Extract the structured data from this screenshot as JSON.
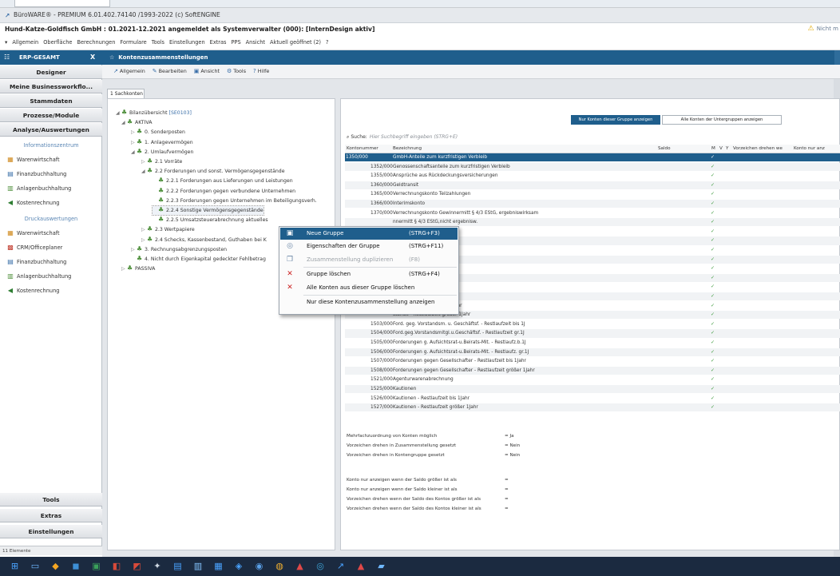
{
  "window": {
    "title": "BüroWARE® - PREMIUM 6.01.402.74140 /1993-2022 (c) SoftENGINE",
    "info": "Hund-Katze-Goldfisch GmbH : 01.2021-12.2021 angemeldet als Systemverwalter (000): [InternDesign aktiv]",
    "warning": "Nicht m"
  },
  "menu": [
    "Allgemein",
    "Oberfläche",
    "Berechnungen",
    "Formulare",
    "Tools",
    "Einstellungen",
    "Extras",
    "PPS",
    "Ansicht",
    "Aktuell geöffnet (2)",
    "?"
  ],
  "left_panel": {
    "header": "ERP-GESAMT",
    "close": "X",
    "buttons_top": [
      "Designer",
      "Meine Businessworkflo...",
      "Stammdaten",
      "Prozesse/Module",
      "Analyse/Auswertungen"
    ],
    "group1": "Informationszentrum",
    "items1": [
      {
        "label": "Warenwirtschaft",
        "icon": "package-icon"
      },
      {
        "label": "Finanzbuchhaltung",
        "icon": "finance-icon"
      },
      {
        "label": "Anlagenbuchhaltung",
        "icon": "chart-icon"
      },
      {
        "label": "Kostenrechnung",
        "icon": "cost-icon"
      }
    ],
    "group2": "Druckauswertungen",
    "items2": [
      {
        "label": "Warenwirtschaft",
        "icon": "package-icon"
      },
      {
        "label": "CRM/Officeplaner",
        "icon": "calendar-icon"
      },
      {
        "label": "Finanzbuchhaltung",
        "icon": "finance-icon"
      },
      {
        "label": "Anlagenbuchhaltung",
        "icon": "chart-icon"
      },
      {
        "label": "Kostenrechnung",
        "icon": "cost-icon"
      }
    ],
    "buttons_bottom": [
      "Tools",
      "Extras",
      "Einstellungen"
    ],
    "status": "11 Elemente"
  },
  "document": {
    "title": "Kontenzusammenstellungen",
    "toolbar": [
      "Allgemein",
      "Bearbeiten",
      "Ansicht",
      "Tools",
      "Hilfe"
    ],
    "subtab": "1 Sachkonten"
  },
  "tree": [
    {
      "label": "Bilanzübersicht",
      "extra": "[SE0103]",
      "level": 0,
      "toggle": "◢"
    },
    {
      "label": "AKTIVA",
      "level": 1,
      "toggle": "◢"
    },
    {
      "label": "0. Sonderposten",
      "level": 2,
      "toggle": "▷"
    },
    {
      "label": "1. Anlagevermögen",
      "level": 2,
      "toggle": "▷"
    },
    {
      "label": "2. Umlaufvermögen",
      "level": 2,
      "toggle": "◢"
    },
    {
      "label": "2.1 Vorräte",
      "level": 3,
      "toggle": "▷"
    },
    {
      "label": "2.2 Forderungen und sonst. Vermögensgegenstände",
      "level": 3,
      "toggle": "◢"
    },
    {
      "label": "2.2.1 Forderungen aus Lieferungen und Leistungen",
      "level": 4,
      "toggle": ""
    },
    {
      "label": "2.2.2 Forderungen gegen verbundene Unternehmen",
      "level": 4,
      "toggle": ""
    },
    {
      "label": "2.2.3 Forderungen gegen Unternehmen im Beteiligungsverh.",
      "level": 4,
      "toggle": ""
    },
    {
      "label": "2.2.4 Sonstige Vermögensgegenstände",
      "level": 4,
      "toggle": ""
    },
    {
      "label": "2.2.5 Umsatzsteuerabrechnung aktuelles",
      "level": 4,
      "toggle": ""
    },
    {
      "label": "2.3 Wertpapiere",
      "level": 3,
      "toggle": "▷"
    },
    {
      "label": "2.4 Schecks, Kassenbestand, Guthaben bei K",
      "level": 3,
      "toggle": "▷"
    },
    {
      "label": "3. Rechnungsabgrenzungsposten",
      "level": 2,
      "toggle": "▷"
    },
    {
      "label": "4. Nicht durch Eigenkapital gedeckter Fehlbetrag",
      "level": 2,
      "toggle": ""
    },
    {
      "label": "PASSIVA",
      "level": 1,
      "toggle": "▷"
    }
  ],
  "right": {
    "btn_nur": "Nur Konten dieser Gruppe anzeigen",
    "btn_alle": "Alle Konten der Untergruppen anzeigen",
    "search_label": "Suche:",
    "search_placeholder": "Hier Suchbegriff eingeben (STRG+E)",
    "columns": [
      "Kontonummer",
      "Bezeichnung",
      "Saldo",
      "M",
      "V",
      "Y",
      "Vorzeichen drehen we",
      "Konto nur anz"
    ],
    "rows": [
      {
        "num": "1350/000",
        "name": "GmbH-Anteile zum kurzfristigen Verbleib",
        "sel": true
      },
      {
        "num": "1352/000",
        "name": "Genossenschaftsanteile zum kurzfristigen Verbleib"
      },
      {
        "num": "1355/000",
        "name": "Ansprüche aus Rückdeckungsversicherungen"
      },
      {
        "num": "1360/000",
        "name": "Geldtransit"
      },
      {
        "num": "1365/000",
        "name": "Verrechnungskonto Teilzahlungen"
      },
      {
        "num": "1366/000",
        "name": "Interimskonto"
      },
      {
        "num": "1370/000",
        "name": "Verrechnungskonto Gewinnermitt § 4/3 EStG, ergebniswirksam"
      },
      {
        "num": "",
        "name": "nnermitt § 4/3 EStG,nicht ergebnisw."
      },
      {
        "num": "",
        "name": ""
      },
      {
        "num": "",
        "name": ""
      },
      {
        "num": "",
        "name": ""
      },
      {
        "num": "",
        "name": ""
      },
      {
        "num": "",
        "name": ""
      },
      {
        "num": "",
        "name": "stellen"
      },
      {
        "num": "",
        "name": "esteuerung"
      },
      {
        "num": "",
        "name": "stände"
      },
      {
        "num": "",
        "name": "stände - Restlaufzeit bis 1Jahr"
      },
      {
        "num": "",
        "name": "stände - Restlaufzeit größer 1Jahr"
      },
      {
        "num": "1503/000",
        "name": "Ford. geg. Vorstandsm. u. Geschäftsf. - Restlaufzeit bis 1J"
      },
      {
        "num": "1504/000",
        "name": "Ford.geg.Vorstandsmitgl.u.Geschäftsf. - Restlaufzeit gr.1J"
      },
      {
        "num": "1505/000",
        "name": "Forderungen g. Aufsichtsrat-u.Beirats-Mit. - Restlaufz.b.1J"
      },
      {
        "num": "1506/000",
        "name": "Forderungen g. Aufsichtsrat-u.Beirats-Mit. - Restlaufz. gr.1J"
      },
      {
        "num": "1507/000",
        "name": "Forderungen gegen Gesellschafter - Restlaufzeit bis 1Jahr"
      },
      {
        "num": "1508/000",
        "name": "Forderungen gegen Gesellschafter - Restlaufzeit größer 1Jahr"
      },
      {
        "num": "1521/000",
        "name": "Agenturwarenabrechnung"
      },
      {
        "num": "1525/000",
        "name": "Kautionen"
      },
      {
        "num": "1526/000",
        "name": "Kautionen - Restlaufzeit bis 1Jahr"
      },
      {
        "num": "1527/000",
        "name": "Kautionen - Restlaufzeit größer 1Jahr"
      }
    ],
    "checkmark": "✓",
    "props": [
      {
        "label": "Mehrfachzuordnung von Konten möglich",
        "value": "= Ja"
      },
      {
        "label": "Vorzeichen drehen in Zusammenstellung gesetzt",
        "value": "= Nein"
      },
      {
        "label": "Vorzeichen drehen in Kontengruppe gesetzt",
        "value": "= Nein"
      },
      {
        "label": "",
        "value": ""
      },
      {
        "label": "Konto nur anzeigen wenn der Saldo größer ist als",
        "value": "="
      },
      {
        "label": "Konto nur anzeigen wenn der Saldo kleiner ist als",
        "value": "="
      },
      {
        "label": "Vorzeichen drehen wenn der Saldo des Kontos größer ist als",
        "value": "="
      },
      {
        "label": "Vorzeichen drehen wenn der Saldo des Kontos kleiner ist als",
        "value": "="
      }
    ]
  },
  "context_menu": [
    {
      "label": "Neue Gruppe",
      "shortcut": "(STRG+F3)",
      "icon": "new-group-icon",
      "state": "hl"
    },
    {
      "label": "Eigenschaften der Gruppe",
      "shortcut": "(STRG+F11)",
      "icon": "properties-icon",
      "state": ""
    },
    {
      "label": "Zusammenstellung duplizieren",
      "shortcut": "(F8)",
      "icon": "duplicate-icon",
      "state": "dis"
    },
    {
      "label": "Gruppe löschen",
      "shortcut": "(STRG+F4)",
      "icon": "delete-icon",
      "state": ""
    },
    {
      "label": "Alle Konten aus dieser Gruppe löschen",
      "shortcut": "",
      "icon": "delete-all-icon",
      "state": ""
    },
    {
      "label": "Nur diese Kontenzusammenstellung anzeigen",
      "shortcut": "",
      "icon": "",
      "state": ""
    }
  ]
}
